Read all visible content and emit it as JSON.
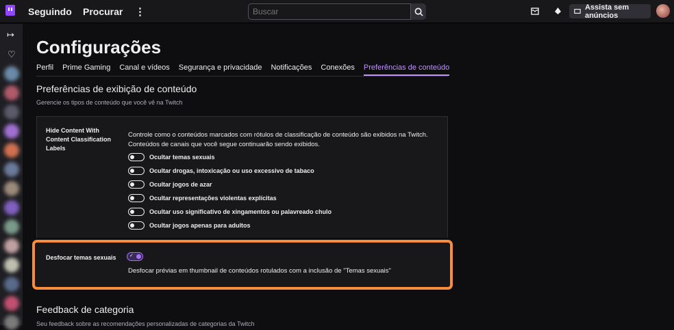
{
  "topbar": {
    "following": "Seguindo",
    "browse": "Procurar",
    "more": "⋮",
    "search_placeholder": "Buscar",
    "ads_button": "Assista sem anúncios"
  },
  "page": {
    "title": "Configurações",
    "tabs": [
      "Perfil",
      "Prime Gaming",
      "Canal e vídeos",
      "Segurança e privacidade",
      "Notificações",
      "Conexões",
      "Preferências de conteúdo"
    ],
    "active_tab": "Preferências de conteúdo"
  },
  "section": {
    "title": "Preferências de exibição de conteúdo",
    "subtitle": "Gerencie os tipos de conteúdo que você vê na Twitch"
  },
  "ccl": {
    "label": "Hide Content With Content Classification Labels",
    "description": "Controle como o conteúdos marcados com rótulos de classificação de conteúdo são exibidos na Twitch. Conteúdos de canais que você segue continuarão sendo exibidos.",
    "toggles": [
      {
        "label": "Ocultar temas sexuais",
        "on": false
      },
      {
        "label": "Ocultar drogas, intoxicação ou uso excessivo de tabaco",
        "on": false
      },
      {
        "label": "Ocultar jogos de azar",
        "on": false
      },
      {
        "label": "Ocultar representações violentas explícitas",
        "on": false
      },
      {
        "label": "Ocultar uso significativo de xingamentos ou palavreado chulo",
        "on": false
      },
      {
        "label": "Ocultar jogos apenas para adultos",
        "on": false
      }
    ]
  },
  "blur": {
    "label": "Desfocar temas sexuais",
    "on": true,
    "check": "✓",
    "description": "Desfocar prévias em thumbnail de conteúdos rotulados com a inclusão de \"Temas sexuais\""
  },
  "feedback": {
    "title": "Feedback de categoria",
    "subtitle": "Seu feedback sobre as recomendações personalizadas de categorias da Twitch"
  },
  "colors": {
    "accent": "#bf94ff",
    "highlight": "#fb8c3a",
    "brand": "#9147ff"
  }
}
